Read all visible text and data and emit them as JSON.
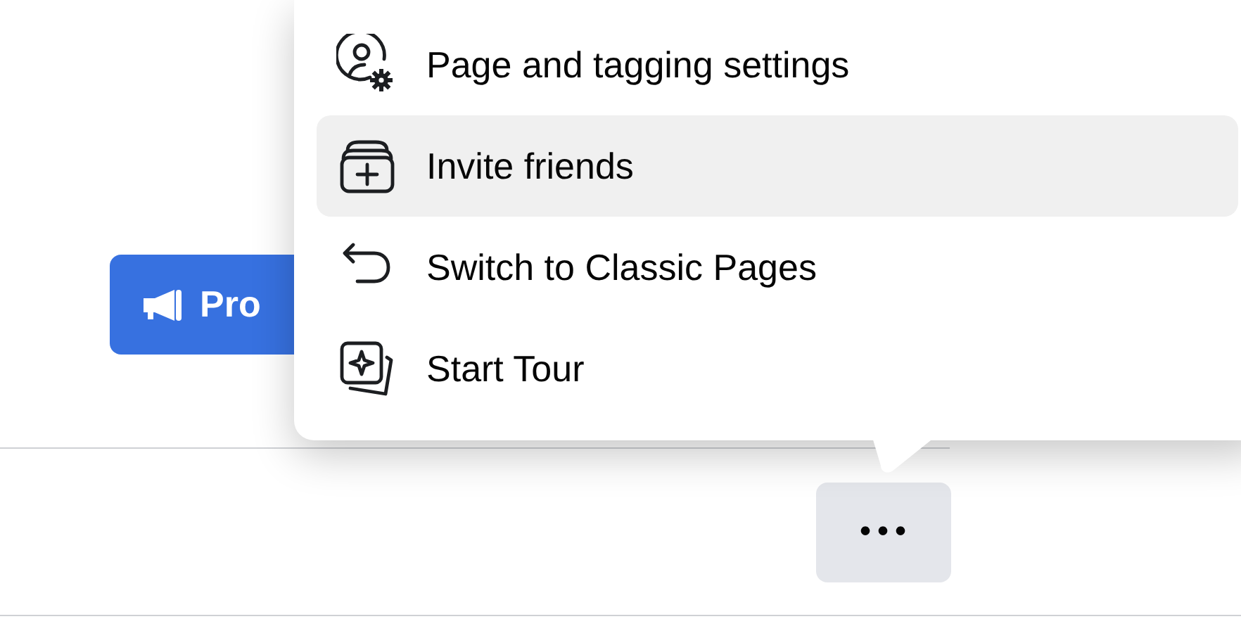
{
  "promote_button": {
    "label": "Pro"
  },
  "menu": {
    "items": [
      {
        "label": "Page and tagging settings",
        "selected": false
      },
      {
        "label": "Invite friends",
        "selected": true
      },
      {
        "label": "Switch to Classic Pages",
        "selected": false
      },
      {
        "label": "Start Tour",
        "selected": false
      }
    ]
  },
  "more_button": {
    "label": "•••"
  }
}
